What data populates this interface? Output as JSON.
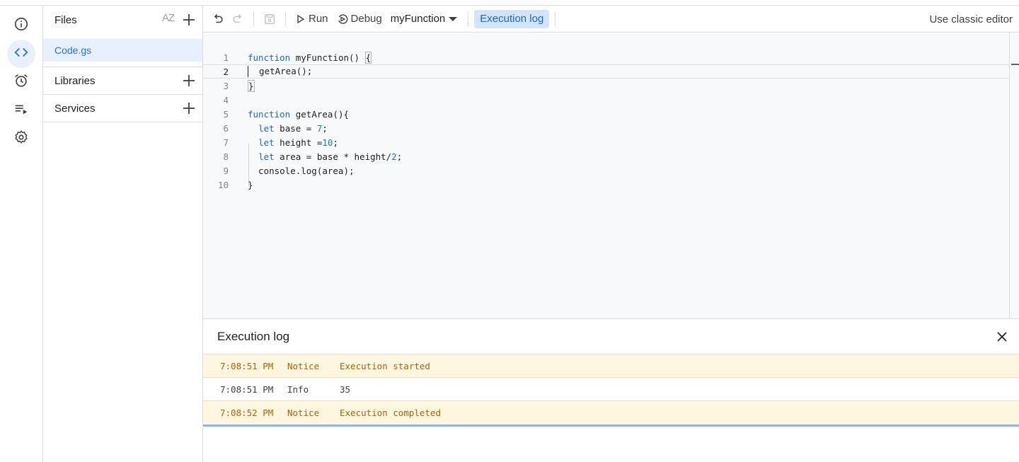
{
  "sidebar": {
    "files_label": "Files",
    "sort_label": "AZ",
    "file_items": [
      "Code.gs"
    ],
    "libraries_label": "Libraries",
    "services_label": "Services"
  },
  "toolbar": {
    "run_label": "Run",
    "debug_label": "Debug",
    "function_select": "myFunction",
    "execution_log_label": "Execution log",
    "classic_editor_label": "Use classic editor"
  },
  "editor": {
    "line_numbers": [
      "1",
      "2",
      "3",
      "4",
      "5",
      "6",
      "7",
      "8",
      "9",
      "10"
    ],
    "current_line": 2
  },
  "log": {
    "title": "Execution log",
    "rows": [
      {
        "time": "7:08:51 PM",
        "level": "Notice",
        "message": "Execution started"
      },
      {
        "time": "7:08:51 PM",
        "level": "Info",
        "message": "35"
      },
      {
        "time": "7:08:52 PM",
        "level": "Notice",
        "message": "Execution completed"
      }
    ]
  },
  "colors": {
    "accent": "#1a73e8",
    "notice_bg": "#fef7e0",
    "notice_text": "#b06000"
  },
  "icons": [
    "info-icon",
    "code-icon",
    "alarm-icon",
    "executions-icon",
    "settings-icon",
    "undo-icon",
    "redo-icon",
    "save-icon",
    "play-icon",
    "debug-icon",
    "dropdown-arrow-icon",
    "close-icon",
    "add-icon"
  ]
}
